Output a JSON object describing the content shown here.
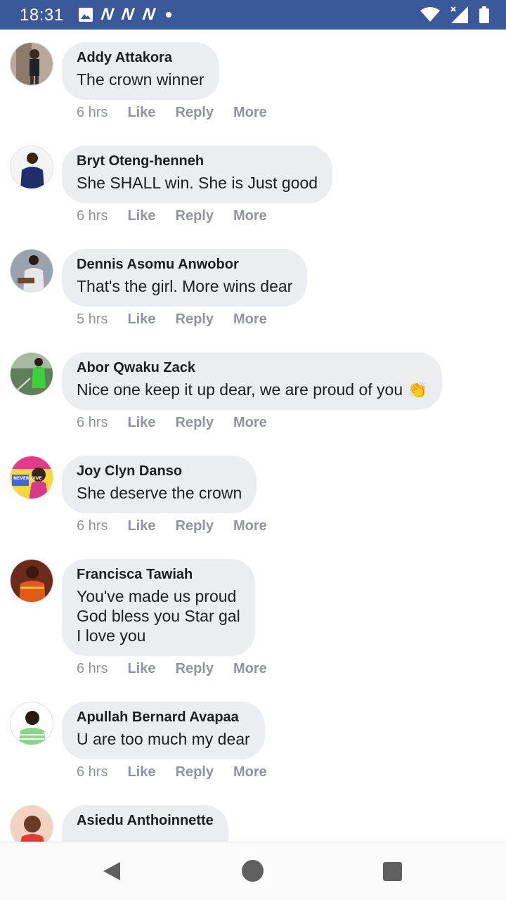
{
  "status_bar": {
    "time": "18:31",
    "notification_icons": [
      "image-icon",
      "n-icon",
      "n-icon",
      "n-icon",
      "dot-icon"
    ],
    "system_icons": [
      "wifi-icon",
      "signal-icon",
      "battery-icon"
    ]
  },
  "comments": [
    {
      "name": "Addy Attakora",
      "text": "The crown winner",
      "time": "6 hrs"
    },
    {
      "name": "Bryt Oteng-henneh",
      "text": "She SHALL win. She is Just good",
      "time": "6 hrs"
    },
    {
      "name": "Dennis Asomu Anwobor",
      "text": "That's the girl. More wins dear",
      "time": "5 hrs"
    },
    {
      "name": "Abor Qwaku Zack",
      "text": "Nice one keep it up dear, we are proud of you 👏",
      "time": "6 hrs"
    },
    {
      "name": "Joy Clyn Danso",
      "text": "She deserve the crown",
      "time": "6 hrs"
    },
    {
      "name": "Francisca Tawiah",
      "text": "You've made us proud\nGod bless you Star gal\nI love you",
      "time": "6 hrs"
    },
    {
      "name": "Apullah Bernard Avapaa",
      "text": "U are too much my dear",
      "time": "6 hrs"
    },
    {
      "name": "Asiedu Anthoinnette",
      "text": "",
      "time": ""
    }
  ],
  "actions": {
    "like": "Like",
    "reply": "Reply",
    "more": "More"
  },
  "avatar_badge_text": "NEVER GIVE",
  "colors": {
    "status_bar": "#3b5998",
    "bubble": "#ebedf0",
    "meta": "#90949c"
  }
}
